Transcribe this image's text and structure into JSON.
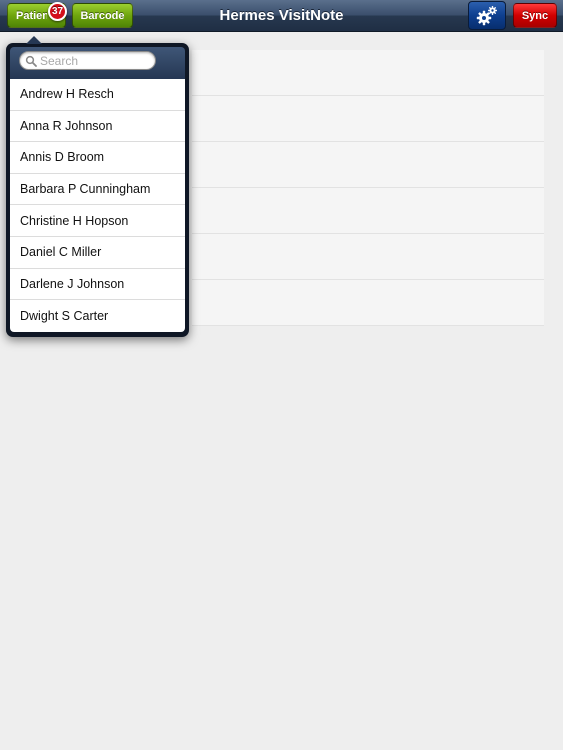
{
  "navbar": {
    "title": "Hermes VisitNote",
    "patients_label": "Patients",
    "patients_badge": "37",
    "barcode_label": "Barcode",
    "settings_icon": "gear-icon",
    "sync_label": "Sync"
  },
  "colors": {
    "nav_bar": "#2d3f5a",
    "green_button": "#6fa50e",
    "settings_button": "#0e3f8f",
    "sync_button": "#d10000",
    "badge": "#d3101a"
  },
  "patient_popover": {
    "search": {
      "placeholder": "Search",
      "value": ""
    },
    "patients": [
      "Andrew H Resch",
      "Anna R Johnson",
      "Annis D Broom",
      "Barbara P Cunningham",
      "Christine H Hopson",
      "Daniel C Miller",
      "Darlene J Johnson",
      "Dwight S Carter"
    ]
  },
  "background_table": {
    "row_count": 6
  }
}
